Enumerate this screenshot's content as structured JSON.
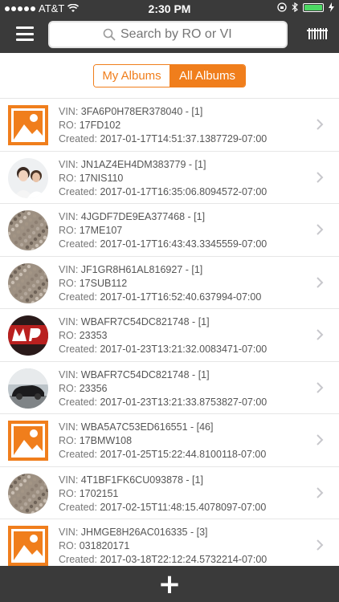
{
  "status_bar": {
    "carrier": "AT&T",
    "time": "2:30 PM"
  },
  "search": {
    "placeholder": "Search by RO or VIN"
  },
  "segments": {
    "my_albums": "My Albums",
    "all_albums": "All Albums",
    "selected": "All Albums"
  },
  "labels": {
    "vin": "VIN:",
    "ro": "RO:",
    "created": "Created:"
  },
  "albums": [
    {
      "vin": "3FA6P0H78ER378040 - [1]",
      "ro": "17FD102",
      "created": "2017-01-17T14:51:37.1387729-07:00",
      "thumb": "placeholder-image-icon"
    },
    {
      "vin": "JN1AZ4EH4DM383779 - [1]",
      "ro": "17NIS110",
      "created": "2017-01-17T16:35:06.8094572-07:00",
      "thumb": "photo-people"
    },
    {
      "vin": "4JGDF7DE9EA377468 - [1]",
      "ro": "17ME107",
      "created": "2017-01-17T16:43:43.3345559-07:00",
      "thumb": "photo-texture"
    },
    {
      "vin": "JF1GR8H61AL816927 - [1]",
      "ro": "17SUB112",
      "created": "2017-01-17T16:52:40.637994-07:00",
      "thumb": "photo-texture"
    },
    {
      "vin": "WBAFR7C54DC821748 - [1]",
      "ro": "23353",
      "created": "2017-01-23T13:21:32.0083471-07:00",
      "thumb": "photo-logo"
    },
    {
      "vin": "WBAFR7C54DC821748 - [1]",
      "ro": "23356",
      "created": "2017-01-23T13:21:33.8753827-07:00",
      "thumb": "photo-car"
    },
    {
      "vin": "WBA5A7C53ED616551 - [46]",
      "ro": "17BMW108",
      "created": "2017-01-25T15:22:44.8100118-07:00",
      "thumb": "placeholder-image-icon"
    },
    {
      "vin": "4T1BF1FK6CU093878 - [1]",
      "ro": "1702151",
      "created": "2017-02-15T11:48:15.4078097-07:00",
      "thumb": "photo-texture"
    },
    {
      "vin": "JHMGE8H26AC016335 - [3]",
      "ro": "031820171",
      "created": "2017-03-18T22:12:24.5732214-07:00",
      "thumb": "placeholder-image-icon"
    }
  ],
  "colors": {
    "accent": "#f07e1c",
    "bar": "#3a3a3a"
  }
}
